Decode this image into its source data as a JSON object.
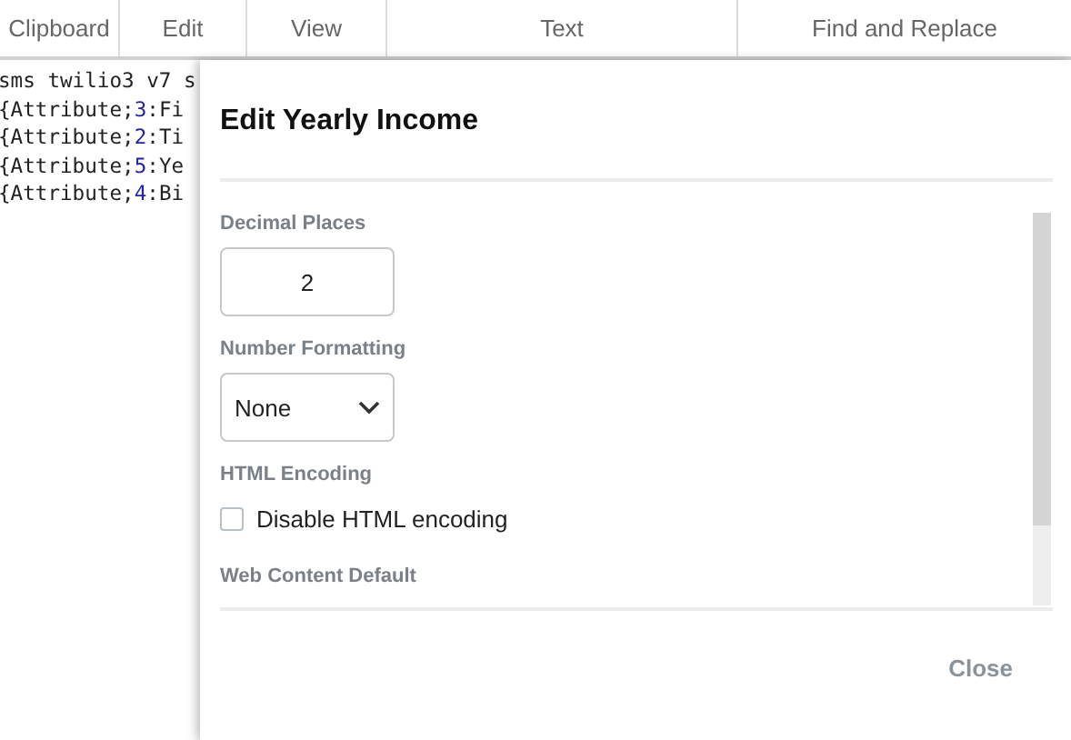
{
  "ribbon_tabs": [
    {
      "label": "Clipboard"
    },
    {
      "label": "Edit"
    },
    {
      "label": "View"
    },
    {
      "label": "Text"
    },
    {
      "label": "Find and Replace"
    }
  ],
  "code_lines": [
    {
      "before": "sms twilio3 v7 s"
    },
    {
      "before": "{Attribute;",
      "number": "3",
      "after": ":Fi"
    },
    {
      "before": "{Attribute;",
      "number": "2",
      "after": ":Ti"
    },
    {
      "before": "{Attribute;",
      "number": "5",
      "after": ":Ye"
    },
    {
      "before": "{Attribute;",
      "number": "4",
      "after": ":Bi"
    }
  ],
  "dialog": {
    "title": "Edit Yearly Income",
    "fields": [
      {
        "kind": "number",
        "label": "Decimal Places",
        "value": "2"
      },
      {
        "kind": "select",
        "label": "Number Formatting",
        "value": "None"
      },
      {
        "kind": "checkbox",
        "label": "HTML Encoding",
        "option": "Disable HTML encoding",
        "checked": false
      },
      {
        "kind": "heading",
        "label": "Web Content Default"
      }
    ],
    "buttons": [
      "Close"
    ]
  }
}
